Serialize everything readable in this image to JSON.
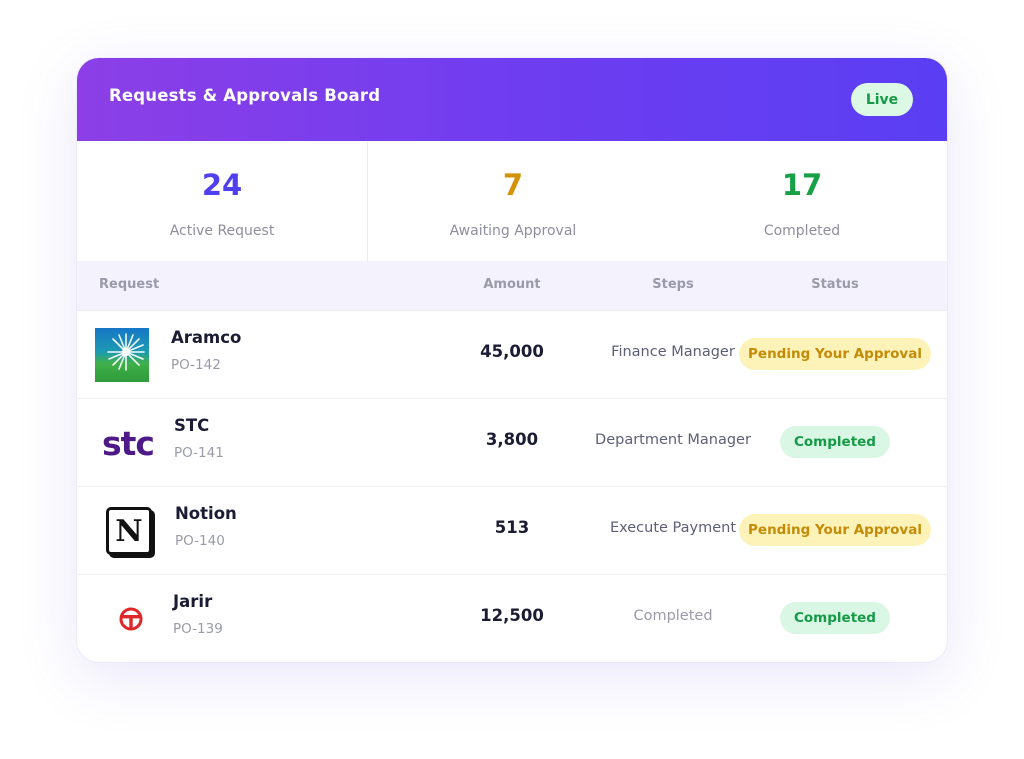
{
  "header": {
    "title": "Requests & Approvals Board",
    "live_badge": "Live"
  },
  "stats": [
    {
      "value": "24",
      "label": "Active Request",
      "color": "#4f3ff0"
    },
    {
      "value": "7",
      "label": "Awaiting Approval",
      "color": "#d49307"
    },
    {
      "value": "17",
      "label": "Completed",
      "color": "#18a047"
    }
  ],
  "table": {
    "columns": [
      "Request",
      "Amount",
      "Steps",
      "Status"
    ],
    "rows": [
      {
        "logo": "aramco-logo",
        "name": "Aramco",
        "id": "PO-142",
        "amount": "45,000",
        "step": "Finance Manager",
        "status": "Pending Your Approval",
        "status_type": "pending"
      },
      {
        "logo": "stc-logo",
        "logo_text": "stc",
        "name": "STC",
        "id": "PO-141",
        "amount": "3,800",
        "step": "Department Manager",
        "status": "Completed",
        "status_type": "done"
      },
      {
        "logo": "notion-logo",
        "logo_text": "N",
        "name": "Notion",
        "id": "PO-140",
        "amount": "513",
        "step": "Execute Payment",
        "status": "Pending Your Approval",
        "status_type": "pending"
      },
      {
        "logo": "jarir-logo",
        "name": "Jarir",
        "id": "PO-139",
        "amount": "12,500",
        "step": "Completed",
        "status": "Completed",
        "status_type": "done"
      }
    ]
  },
  "colors": {
    "header_gradient_start": "#8c3fe6",
    "header_gradient_end": "#5a3ef3",
    "pending_bg": "#fdf3b8",
    "pending_text": "#c58b07",
    "done_bg": "#d9f7e4",
    "done_text": "#179a48"
  }
}
